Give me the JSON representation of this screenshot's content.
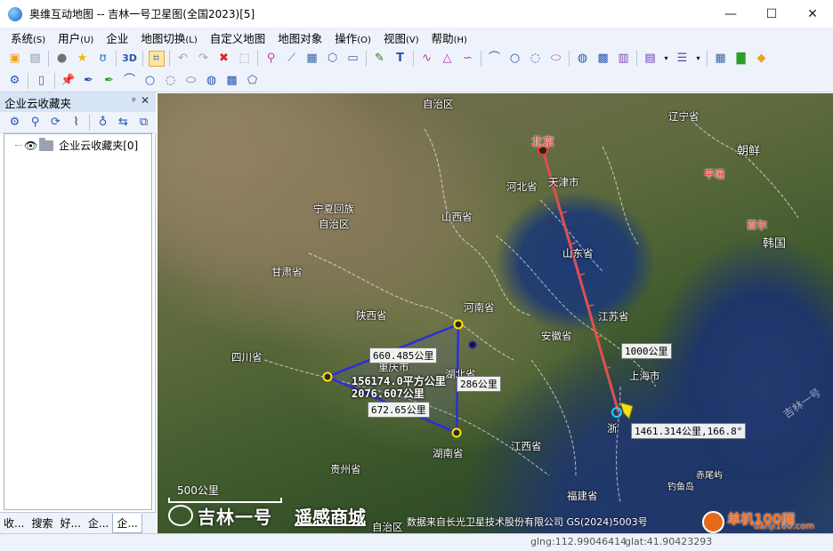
{
  "window": {
    "title": "奥维互动地图 -- 吉林一号卫星图(全国2023)[5]",
    "minimize": "—",
    "maximize": "☐",
    "close": "✕"
  },
  "menu": [
    {
      "label": "系统",
      "acc": "(S)"
    },
    {
      "label": "用户",
      "acc": "(U)"
    },
    {
      "label": "企业",
      "acc": ""
    },
    {
      "label": "地图切换",
      "acc": "(L)"
    },
    {
      "label": "自定义地图",
      "acc": ""
    },
    {
      "label": "地图对象",
      "acc": ""
    },
    {
      "label": "操作",
      "acc": "(O)"
    },
    {
      "label": "视图",
      "acc": "(V)"
    },
    {
      "label": "帮助",
      "acc": "(H)"
    }
  ],
  "toolbar1_icons": [
    "open-icon",
    "save-icon",
    "user-icon",
    "star-icon",
    "route-icon",
    "3d-icon",
    "measure-icon",
    "undo-icon",
    "redo-icon",
    "delete-icon",
    "select-icon",
    "marker-icon",
    "ruler-icon",
    "bus-icon",
    "hexagon-icon",
    "video-icon",
    "pin-icon",
    "text-icon",
    "polyline-icon",
    "triangle-icon",
    "curve-icon",
    "arc-icon",
    "circle-icon",
    "arc2-icon",
    "ellipse-icon",
    "sphere-icon",
    "square-icon",
    "book-icon",
    "layer-icon",
    "list-icon",
    "grid-icon",
    "chat-icon",
    "gem-icon"
  ],
  "toolbar2_icons": [
    "settings-icon",
    "page-icon",
    "pushpin-yellow-icon",
    "pushpin-blue-icon",
    "pushpin-green-icon",
    "line-icon",
    "circle-icon",
    "arc-icon",
    "ellipse-icon",
    "sphere-icon",
    "square-icon",
    "polygon-icon"
  ],
  "panel": {
    "title": "企业云收藏夹",
    "pin": "ᵖ",
    "close": "✕",
    "tools": [
      "gear-icon",
      "search-icon",
      "refresh-icon",
      "attach-icon",
      "location-icon",
      "swap-icon",
      "copy-icon"
    ],
    "tree_item": "企业云收藏夹[0]",
    "tabs": [
      "收...",
      "搜索",
      "好...",
      "企...",
      "企..."
    ]
  },
  "map": {
    "labels": [
      {
        "text": "自治区",
        "cls": ""
      },
      {
        "text": "北京",
        "cls": "red big"
      },
      {
        "text": "辽宁省",
        "cls": ""
      },
      {
        "text": "天津市",
        "cls": ""
      },
      {
        "text": "河北省",
        "cls": ""
      },
      {
        "text": "朝鲜",
        "cls": "big"
      },
      {
        "text": "平壤",
        "cls": "red"
      },
      {
        "text": "首尔",
        "cls": "red"
      },
      {
        "text": "韩国",
        "cls": "big"
      },
      {
        "text": "宁夏回族",
        "cls": ""
      },
      {
        "text": "自治区",
        "cls": ""
      },
      {
        "text": "山西省",
        "cls": ""
      },
      {
        "text": "甘肃省",
        "cls": ""
      },
      {
        "text": "山东省",
        "cls": ""
      },
      {
        "text": "河南省",
        "cls": ""
      },
      {
        "text": "陕西省",
        "cls": ""
      },
      {
        "text": "江苏省",
        "cls": ""
      },
      {
        "text": "安徽省",
        "cls": ""
      },
      {
        "text": "四川省",
        "cls": ""
      },
      {
        "text": "重庆市",
        "cls": ""
      },
      {
        "text": "湖北省",
        "cls": ""
      },
      {
        "text": "上海市",
        "cls": ""
      },
      {
        "text": "江西省",
        "cls": ""
      },
      {
        "text": "湖南省",
        "cls": ""
      },
      {
        "text": "贵州省",
        "cls": ""
      },
      {
        "text": "赤尾屿",
        "cls": "small"
      },
      {
        "text": "钓鱼岛",
        "cls": "small"
      },
      {
        "text": "福建省",
        "cls": ""
      },
      {
        "text": "浙",
        "cls": ""
      },
      {
        "text": "自治区",
        "cls": ""
      }
    ],
    "measures": {
      "side1": "660.485公里",
      "side2": "286公里",
      "side3": "672.65公里",
      "area": "156174.0平方公里",
      "perimeter": "2076.607公里",
      "tick": "1000公里",
      "line_result": "1461.314公里,166.8°"
    },
    "scale": "500公里",
    "brand_name": "吉林一号",
    "brand_store": "遥感商城",
    "data_source": "数据来自长光卫星技术股份有限公司 GS(2024)5003号",
    "watermark": "吉林一号",
    "site_name": "单机100网",
    "site_url": "danji100.com"
  },
  "status": {
    "lng": "glng:112.99046414",
    "lat": "glat:41.90423293"
  }
}
